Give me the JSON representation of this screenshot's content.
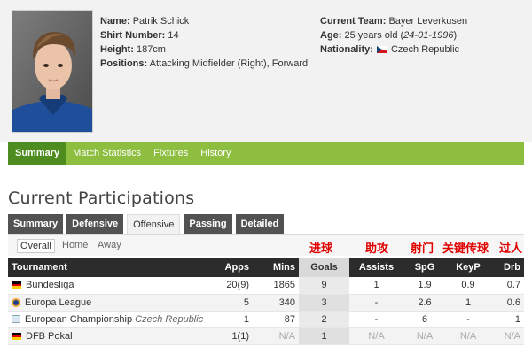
{
  "player": {
    "name_label": "Name:",
    "name": "Patrik Schick",
    "shirt_label": "Shirt Number:",
    "shirt": "14",
    "height_label": "Height:",
    "height": "187cm",
    "positions_label": "Positions:",
    "positions": "Attacking Midfielder (Right), Forward",
    "team_label": "Current Team:",
    "team": "Bayer Leverkusen",
    "age_label": "Age:",
    "age": "25 years old (",
    "dob": "24-01-1996",
    "age_close": ")",
    "nationality_label": "Nationality:",
    "nationality": "Czech Republic",
    "nationality_flag_icon": "czech-flag-icon"
  },
  "nav": {
    "items": [
      {
        "label": "Summary",
        "active": true
      },
      {
        "label": "Match Statistics",
        "active": false
      },
      {
        "label": "Fixtures",
        "active": false
      },
      {
        "label": "History",
        "active": false
      }
    ]
  },
  "section_title": "Current Participations",
  "tabs": [
    {
      "label": "Summary",
      "active": false
    },
    {
      "label": "Defensive",
      "active": false
    },
    {
      "label": "Offensive",
      "active": true
    },
    {
      "label": "Passing",
      "active": false
    },
    {
      "label": "Detailed",
      "active": false
    }
  ],
  "filters": [
    {
      "label": "Overall",
      "active": true
    },
    {
      "label": "Home",
      "active": false
    },
    {
      "label": "Away",
      "active": false
    }
  ],
  "annotations": [
    "进球",
    "助攻",
    "射门",
    "关键传球",
    "过人"
  ],
  "table": {
    "headers": [
      "Tournament",
      "Apps",
      "Mins",
      "Goals",
      "Assists",
      "SpG",
      "KeyP",
      "Drb"
    ],
    "rows": [
      {
        "icon": "germany-flag-icon",
        "tournament": "Bundesliga",
        "country": "",
        "apps": "20(9)",
        "mins": "1865",
        "goals": "9",
        "assists": "1",
        "spg": "1.9",
        "keyp": "0.9",
        "drb": "0.7"
      },
      {
        "icon": "europa-league-icon",
        "tournament": "Europa League",
        "country": "",
        "apps": "5",
        "mins": "340",
        "goals": "3",
        "assists": "-",
        "spg": "2.6",
        "keyp": "1",
        "drb": "0.6"
      },
      {
        "icon": "european-championship-icon",
        "tournament": "European Championship",
        "country": "Czech Republic",
        "apps": "1",
        "mins": "87",
        "goals": "2",
        "assists": "-",
        "spg": "6",
        "keyp": "-",
        "drb": "1"
      },
      {
        "icon": "germany-flag-icon",
        "tournament": "DFB Pokal",
        "country": "",
        "apps": "1(1)",
        "mins": "N/A",
        "goals": "1",
        "assists": "N/A",
        "spg": "N/A",
        "keyp": "N/A",
        "drb": "N/A"
      }
    ]
  },
  "colors": {
    "nav_green": "#8dbe3f",
    "nav_active": "#4e8c1f",
    "header_dark": "#2c2c2c",
    "annotation_red": "#e00000"
  }
}
